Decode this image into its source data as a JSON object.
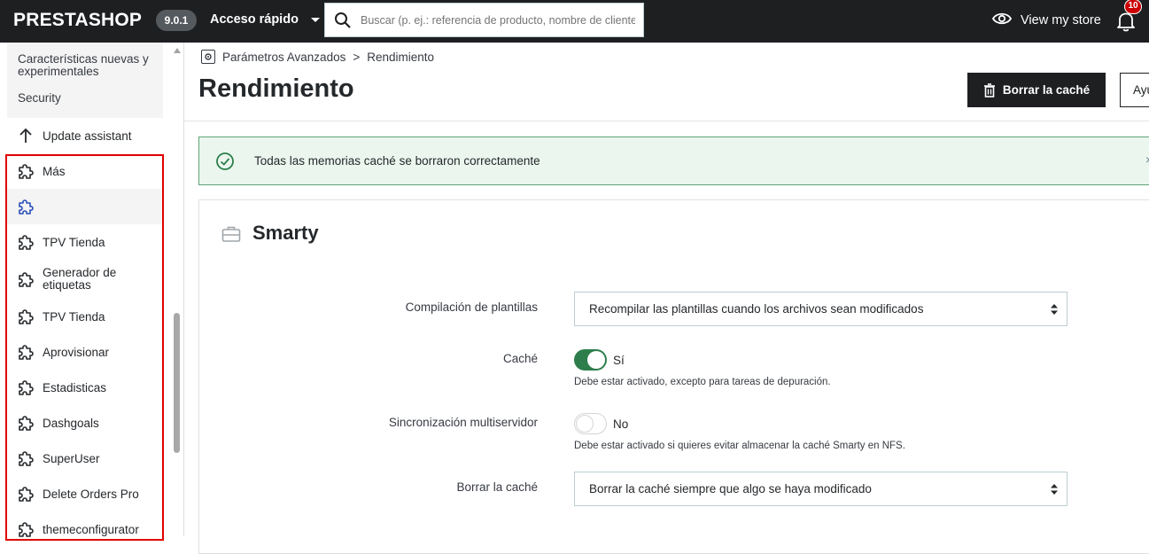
{
  "header": {
    "logo": "PRESTASHOP",
    "version": "9.0.1",
    "quick_access": "Acceso rápido",
    "search_placeholder": "Buscar (p. ej.: referencia de producto, nombre de cliente...",
    "view_store": "View my store",
    "notifications_count": "10"
  },
  "sidebar": {
    "submenu": [
      "Características nuevas y experimentales",
      "Security"
    ],
    "items": [
      {
        "label": "Update assistant",
        "icon": "arrow-up-icon"
      },
      {
        "label": "Más",
        "icon": "puzzle-icon"
      },
      {
        "label": "",
        "icon": "puzzle-icon",
        "active": true
      },
      {
        "label": "TPV Tienda",
        "icon": "puzzle-icon"
      },
      {
        "label": "Generador de etiquetas",
        "icon": "puzzle-icon"
      },
      {
        "label": "TPV Tienda",
        "icon": "puzzle-icon"
      },
      {
        "label": "Aprovisionar",
        "icon": "puzzle-icon"
      },
      {
        "label": "Estadisticas",
        "icon": "puzzle-icon"
      },
      {
        "label": "Dashgoals",
        "icon": "puzzle-icon"
      },
      {
        "label": "SuperUser",
        "icon": "puzzle-icon"
      },
      {
        "label": "Delete Orders Pro",
        "icon": "puzzle-icon"
      },
      {
        "label": "themeconfigurator",
        "icon": "puzzle-icon"
      }
    ]
  },
  "breadcrumb": {
    "parent": "Parámetros Avanzados",
    "separator": ">",
    "current": "Rendimiento"
  },
  "page": {
    "title": "Rendimiento",
    "clear_cache_button": "Borrar la caché",
    "help_button": "Ayuda"
  },
  "alert": {
    "message": "Todas las memorias caché se borraron correctamente",
    "close": "×"
  },
  "smarty": {
    "title": "Smarty",
    "template_compilation": {
      "label": "Compilación de plantillas",
      "value": "Recompilar las plantillas cuando los archivos sean modificados"
    },
    "cache": {
      "label": "Caché",
      "state": "Sí",
      "help": "Debe estar activado, excepto para tareas de depuración."
    },
    "multiserver": {
      "label": "Sincronización multiservidor",
      "state": "No",
      "help": "Debe estar activado si quieres evitar almacenar la caché Smarty en NFS."
    },
    "clear_cache": {
      "label": "Borrar la caché",
      "value": "Borrar la caché siempre que algo se haya modificado"
    }
  },
  "colors": {
    "header_bg": "#1d1f21",
    "success_green": "#2d7e4b",
    "highlight_red": "#e00000"
  }
}
